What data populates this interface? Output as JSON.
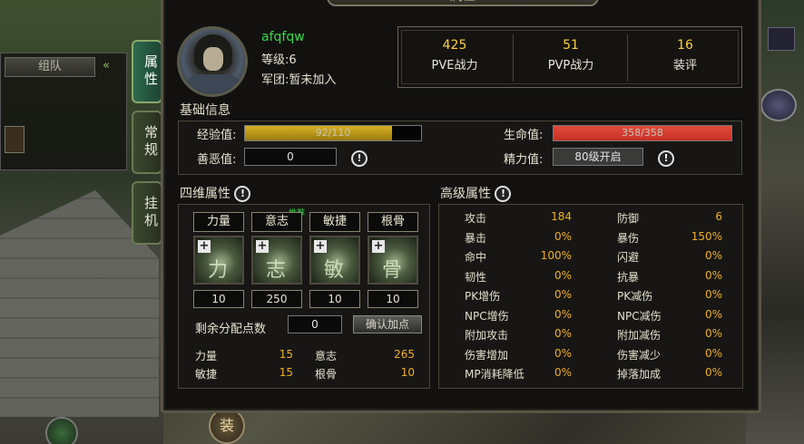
{
  "window": {
    "title": "属性"
  },
  "side_tabs": [
    {
      "label": "属性"
    },
    {
      "label": "常规"
    },
    {
      "label": "挂机"
    }
  ],
  "team_panel": {
    "tab_label": "组队",
    "arrow": "«"
  },
  "player": {
    "name": "afqfqw",
    "level_text": "等级:6",
    "guild_text": "军团:暂未加入"
  },
  "summary_stats": [
    {
      "value": "425",
      "label": "PVE战力"
    },
    {
      "value": "51",
      "label": "PVP战力"
    },
    {
      "value": "16",
      "label": "装评"
    }
  ],
  "basic_info": {
    "title": "基础信息",
    "exp_label": "经验值:",
    "exp_text": "92/110",
    "exp_fraction": 0.836,
    "good_evil_label": "善恶值:",
    "good_evil_value": "0",
    "hp_label": "生命值:",
    "hp_text": "358/358",
    "hp_fraction": 1.0,
    "energy_label": "精力值:",
    "energy_value": "80级开启",
    "info_glyph": "!"
  },
  "four_attrs": {
    "title": "四维属性",
    "recommend_tag": "推荐",
    "items": [
      {
        "name": "力量",
        "value": "10",
        "icon": "strength-icon",
        "glyph": "力"
      },
      {
        "name": "意志",
        "value": "250",
        "icon": "will-icon",
        "glyph": "志"
      },
      {
        "name": "敏捷",
        "value": "10",
        "icon": "agility-icon",
        "glyph": "敏"
      },
      {
        "name": "根骨",
        "value": "10",
        "icon": "constitution-icon",
        "glyph": "骨"
      }
    ],
    "remaining_label": "剩余分配点数",
    "remaining_value": "0",
    "confirm_label": "确认加点",
    "plus_glyph": "+",
    "totals": [
      {
        "label": "力量",
        "value": "15"
      },
      {
        "label": "意志",
        "value": "265"
      },
      {
        "label": "敏捷",
        "value": "15"
      },
      {
        "label": "根骨",
        "value": "10"
      }
    ]
  },
  "advanced": {
    "title": "高级属性",
    "rows": [
      [
        {
          "label": "攻击",
          "value": "184"
        },
        {
          "label": "防御",
          "value": "6"
        }
      ],
      [
        {
          "label": "暴击",
          "value": "0%"
        },
        {
          "label": "暴伤",
          "value": "150%"
        }
      ],
      [
        {
          "label": "命中",
          "value": "100%"
        },
        {
          "label": "闪避",
          "value": "0%"
        }
      ],
      [
        {
          "label": "韧性",
          "value": "0%"
        },
        {
          "label": "抗暴",
          "value": "0%"
        }
      ],
      [
        {
          "label": "PK增伤",
          "value": "0%"
        },
        {
          "label": "PK减伤",
          "value": "0%"
        }
      ],
      [
        {
          "label": "NPC增伤",
          "value": "0%"
        },
        {
          "label": "NPC减伤",
          "value": "0%"
        }
      ],
      [
        {
          "label": "附加攻击",
          "value": "0%"
        },
        {
          "label": "附加减伤",
          "value": "0%"
        }
      ],
      [
        {
          "label": "伤害增加",
          "value": "0%"
        },
        {
          "label": "伤害减少",
          "value": "0%"
        }
      ],
      [
        {
          "label": "MP消耗降低",
          "value": "0%"
        },
        {
          "label": "掉落加成",
          "value": "0%"
        }
      ]
    ]
  },
  "bottom": {
    "equip_label": "装"
  },
  "colors": {
    "exp_bar": "#d8b020",
    "hp_bar": "#c83028",
    "accent_green": "#33dd44",
    "value_orange": "#f0b020"
  }
}
